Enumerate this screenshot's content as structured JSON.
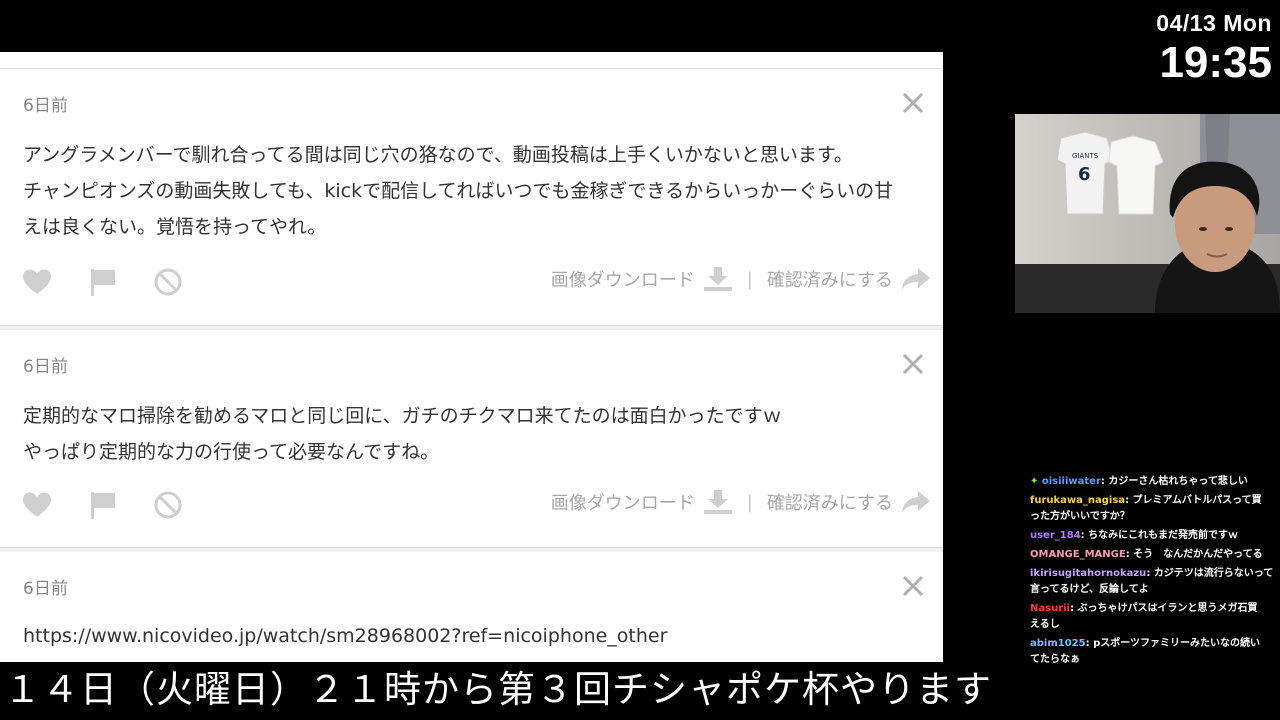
{
  "clock": {
    "date": "04/13 Mon",
    "time": "19:35"
  },
  "cards": [
    {
      "ago": "6日前",
      "lines": [
        "アングラメンバーで馴れ合ってる間は同じ穴の狢なので、動画投稿は上手くいかないと思います。",
        "チャンピオンズの動画失敗しても、kickで配信してればいつでも金稼ぎできるからいっかーぐらいの甘",
        "えは良くない。覚悟を持ってやれ。"
      ],
      "download_label": "画像ダウンロード",
      "separator": "|",
      "confirm_label": "確認済みにする"
    },
    {
      "ago": "6日前",
      "lines": [
        "定期的なマロ掃除を勧めるマロと同じ回に、ガチのチクマロ来てたのは面白かったですｗ",
        "やっぱり定期的な力の行使って必要なんですね。"
      ],
      "download_label": "画像ダウンロード",
      "separator": "|",
      "confirm_label": "確認済みにする"
    },
    {
      "ago": "6日前",
      "lines": [
        "https://www.nicovideo.jp/watch/sm28968002?ref=nicoiphone_other"
      ]
    }
  ],
  "chat": [
    {
      "user": "oisiiiwater",
      "color": "#5aa0ff",
      "badge": "✦",
      "badge_color": "#7cff3a",
      "text": ": カジーさん枯れちゃって悲しい",
      "cont": ""
    },
    {
      "user": "furukawa_nagisa",
      "color": "#ffd24a",
      "text": ": プレミアムバトルパスって買",
      "cont": "った方がいいですか？"
    },
    {
      "user": "user_184",
      "color": "#b57cff",
      "text": ": ちなみにこれもまだ発売前ですｗ",
      "cont": ""
    },
    {
      "user": "OMANGE_MANGE",
      "color": "#ff9ab8",
      "text": ": そう　なんだかんだやってる",
      "cont": ""
    },
    {
      "user": "ikirisugitahornokazu",
      "color": "#c8a0ff",
      "text": ": カジテツは流行らないって",
      "cont": "言ってるけど、反論してよ"
    },
    {
      "user": "Nasurii",
      "color": "#ff3a3a",
      "text": ": ぶっちゃけパスはイランと思うメガ石買",
      "cont": "えるし"
    },
    {
      "user": "abim1025",
      "color": "#6fc3ff",
      "text": ": pスポーツファミリーみたいなの続い",
      "cont": "てたらなぁ"
    }
  ],
  "banner": {
    "text": "１４日（火曜日）２１時から第３回チシャポケ杯やります"
  }
}
